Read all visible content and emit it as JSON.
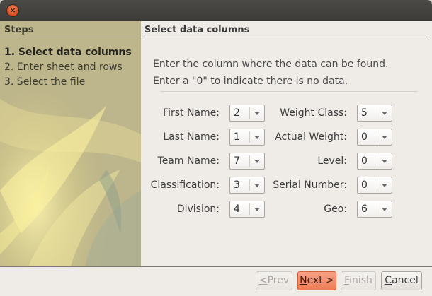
{
  "window": {
    "close_glyph": "×"
  },
  "sidebar": {
    "title": "Steps",
    "steps": [
      {
        "label": "1. Select data columns",
        "active": true
      },
      {
        "label": "2. Enter sheet and rows",
        "active": false
      },
      {
        "label": "3. Select the file",
        "active": false
      }
    ]
  },
  "panel": {
    "title": "Select data columns",
    "instruction_1": "Enter the column where the data can be found.",
    "instruction_2": "Enter a \"0\" to indicate there is no data."
  },
  "fields": {
    "first_name": {
      "label": "First Name:",
      "value": "2"
    },
    "last_name": {
      "label": "Last Name:",
      "value": "1"
    },
    "team_name": {
      "label": "Team Name:",
      "value": "7"
    },
    "classification": {
      "label": "Classification:",
      "value": "3"
    },
    "division": {
      "label": "Division:",
      "value": "4"
    },
    "weight_class": {
      "label": "Weight Class:",
      "value": "5"
    },
    "actual_weight": {
      "label": "Actual Weight:",
      "value": "0"
    },
    "level": {
      "label": "Level:",
      "value": "0"
    },
    "serial_number": {
      "label": "Serial Number:",
      "value": "0"
    },
    "geo": {
      "label": "Geo:",
      "value": "6"
    }
  },
  "buttons": {
    "prev": {
      "mnemonic": "<",
      "label": "Prev",
      "enabled": false
    },
    "next": {
      "label": "Next",
      "mnemonic": "N",
      "rest": "ext >",
      "enabled": true
    },
    "finish": {
      "label": "Finish",
      "mnemonic": "F",
      "rest": "inish",
      "enabled": false
    },
    "cancel": {
      "label": "Cancel",
      "mnemonic": "C",
      "rest": "ancel",
      "enabled": true
    }
  },
  "colors": {
    "accent": "#ee7d56",
    "sidebar": "#b5ae87",
    "titlebar": "#3c3b37"
  }
}
